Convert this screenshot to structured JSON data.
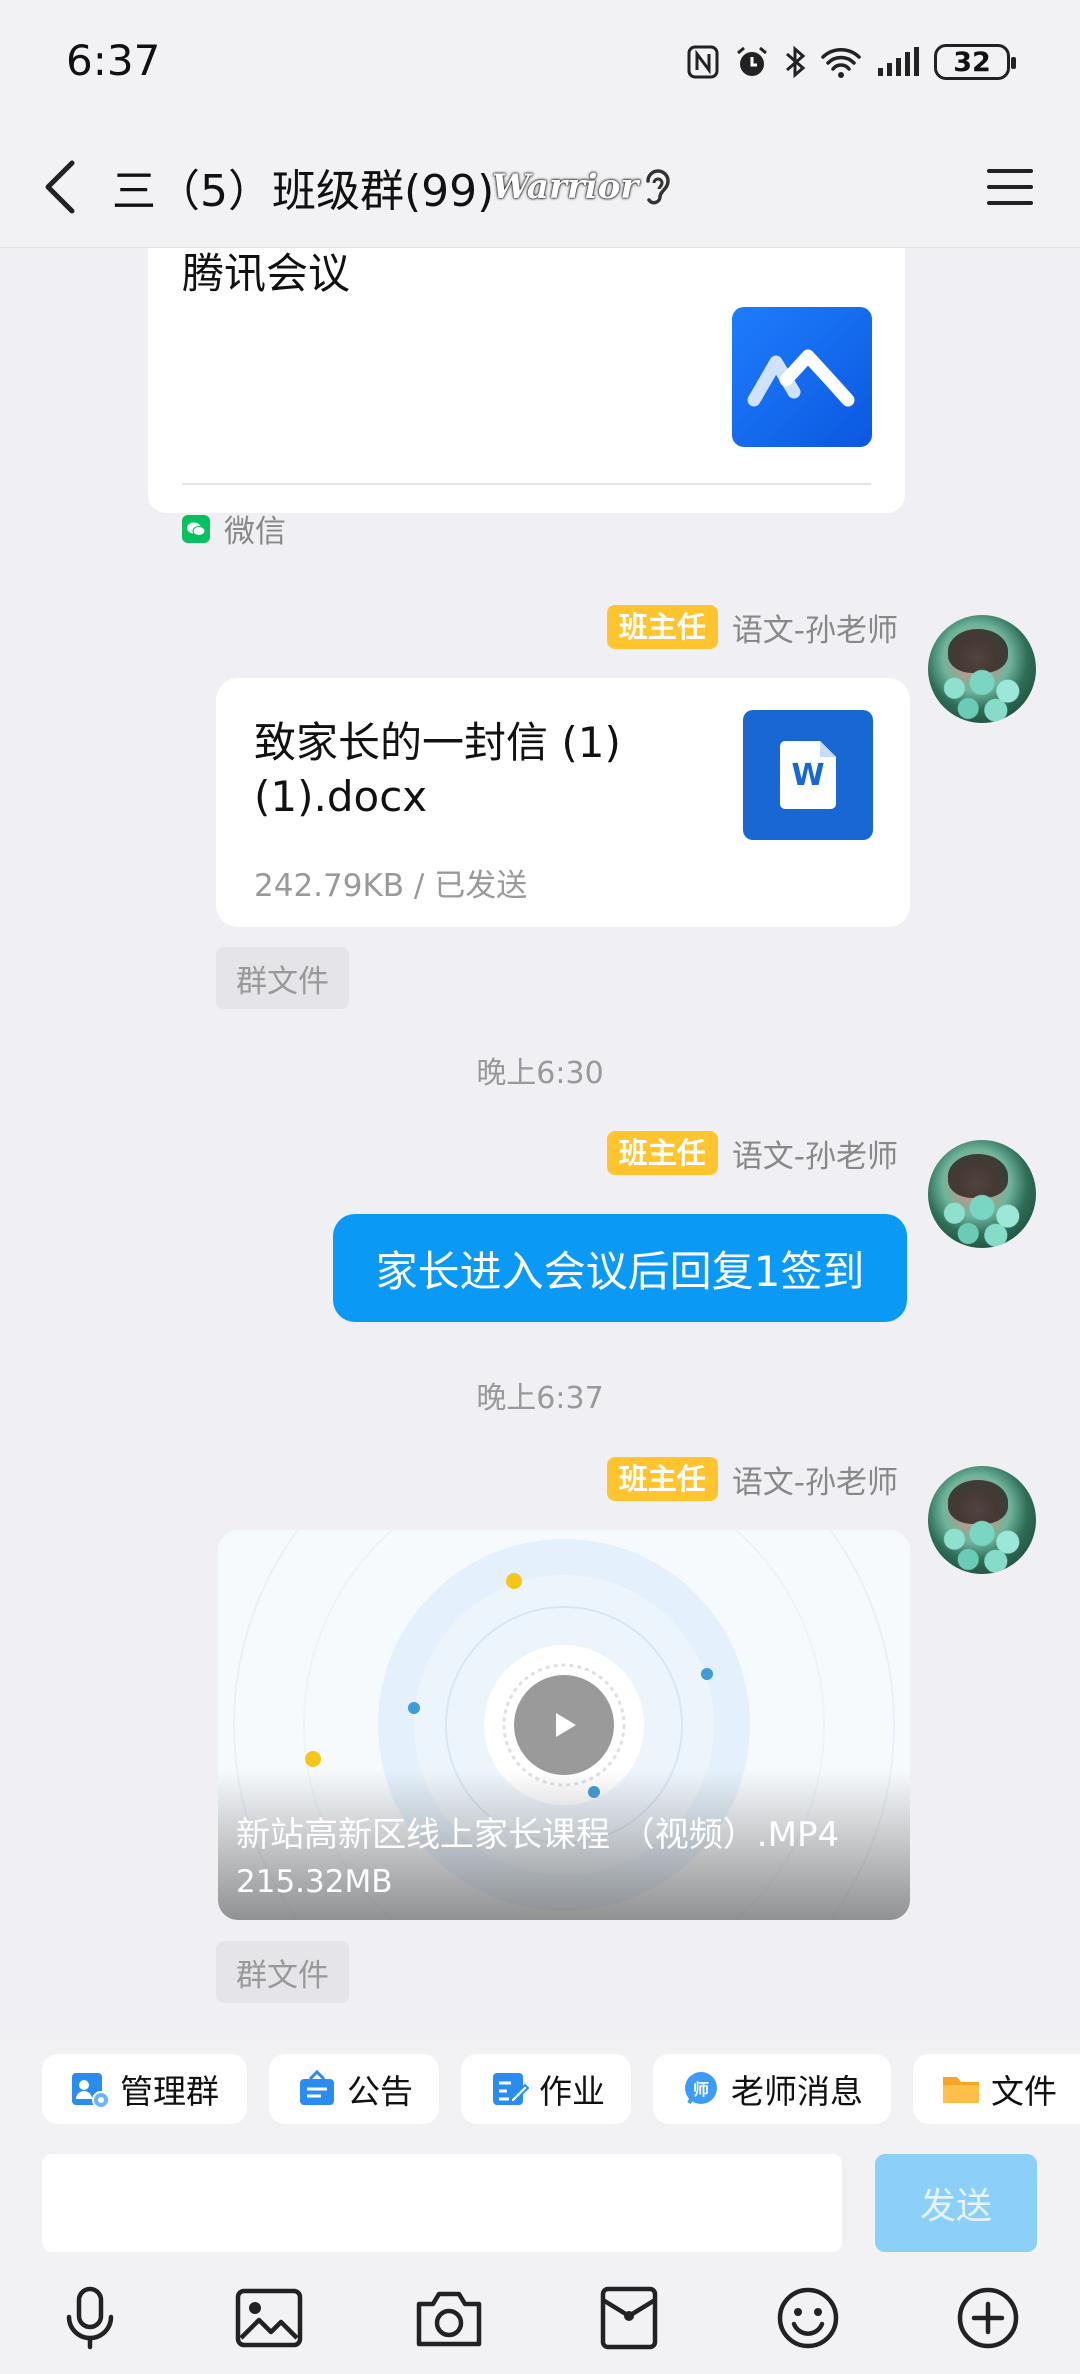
{
  "status_bar": {
    "time": "6:37",
    "battery": "32"
  },
  "header": {
    "title": "三（5）班级群(99)",
    "badge": "Warrior"
  },
  "messages": {
    "shared_card": {
      "title": "腾讯会议",
      "source": "微信"
    },
    "file_message": {
      "role": "班主任",
      "sender": "语文-孙老师",
      "file_name": "致家长的一封信 (1)(1).docx",
      "file_meta": "242.79KB / 已发送",
      "tag": "群文件"
    },
    "time_1": "晚上6:30",
    "text_message": {
      "role": "班主任",
      "sender": "语文-孙老师",
      "text": "家长进入会议后回复1签到"
    },
    "time_2": "晚上6:37",
    "video_message": {
      "role": "班主任",
      "sender": "语文-孙老师",
      "title": "新站高新区线上家长课程 （视频）.MP4",
      "size": "215.32MB",
      "tag": "群文件"
    }
  },
  "quick_actions": [
    {
      "label": "管理群",
      "icon": "manage-group-icon"
    },
    {
      "label": "公告",
      "icon": "announcement-icon"
    },
    {
      "label": "作业",
      "icon": "homework-icon"
    },
    {
      "label": "老师消息",
      "icon": "teacher-message-icon"
    },
    {
      "label": "文件",
      "icon": "folder-icon"
    }
  ],
  "input": {
    "placeholder": "",
    "send_label": "发送"
  },
  "colors": {
    "accent": "#0a99f5",
    "role_badge": "#ffc42e",
    "send_disabled": "#8ccff7"
  }
}
